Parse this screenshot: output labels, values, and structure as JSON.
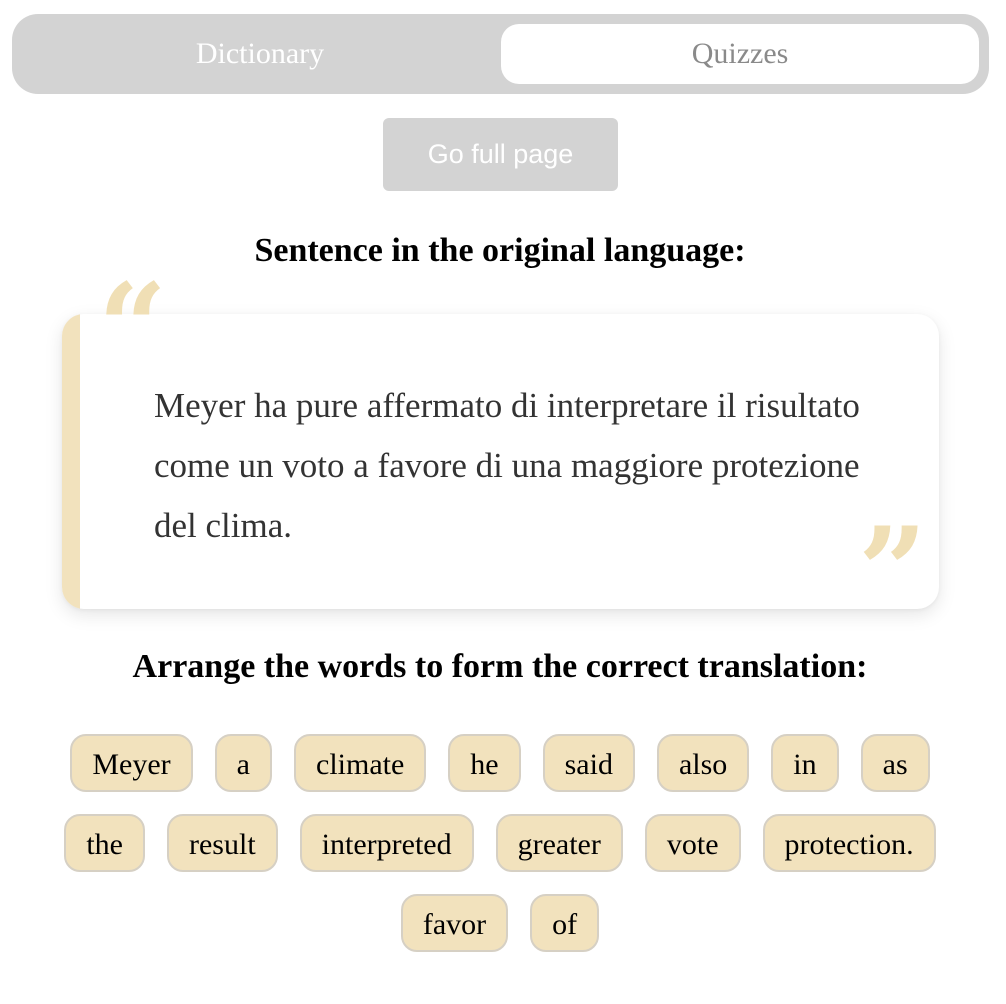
{
  "tabs": {
    "dictionary": "Dictionary",
    "quizzes": "Quizzes",
    "active": "quizzes"
  },
  "full_page_button": "Go full page",
  "original_heading": "Sentence in the original language:",
  "original_sentence": "Meyer ha pure affermato di interpretare il risultato come un voto a favore di una maggiore protezione del clima.",
  "arrange_heading": "Arrange the words to form the correct translation:",
  "word_rows": [
    [
      "Meyer",
      "a",
      "climate",
      "he",
      "said",
      "also",
      "in",
      "as"
    ],
    [
      "the",
      "result",
      "interpreted",
      "greater",
      "vote",
      "protection."
    ],
    [
      "favor",
      "of"
    ]
  ],
  "colors": {
    "tab_bar": "#d3d3d3",
    "accent_cream": "#f2e2bd",
    "chip_border": "#d6d0c4",
    "quote_text": "#333333"
  },
  "icons": {
    "open_quote": "“",
    "close_quote": "”"
  }
}
